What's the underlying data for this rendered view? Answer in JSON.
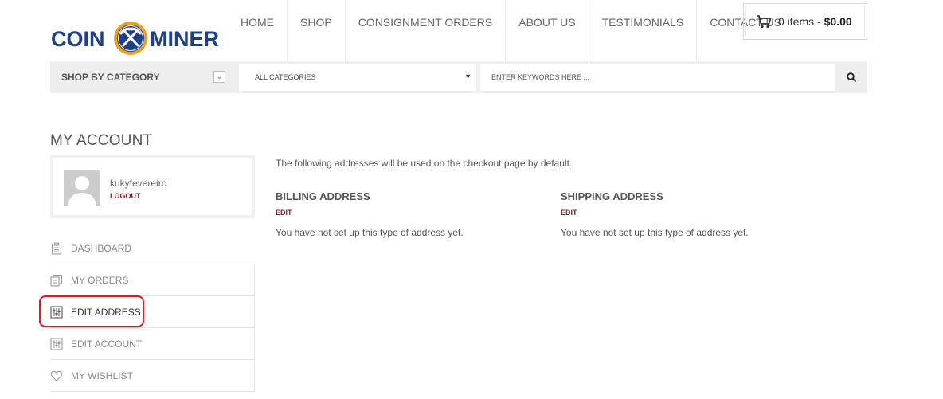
{
  "logo": {
    "left_text": "COIN",
    "right_text": "MINER"
  },
  "nav": {
    "items": [
      {
        "label": "HOME"
      },
      {
        "label": "SHOP"
      },
      {
        "label": "CONSIGNMENT ORDERS"
      },
      {
        "label": "ABOUT US"
      },
      {
        "label": "TESTIMONIALS"
      },
      {
        "label": "CONTACT US"
      }
    ]
  },
  "cart": {
    "items_label": "0 items -",
    "total": "$0.00",
    "icon": "cart-icon"
  },
  "searchbar": {
    "shop_by_label": "SHOP BY CATEGORY",
    "category_value": "ALL CATEGORIES",
    "search_placeholder": "ENTER KEYWORDS HERE ...",
    "search_icon": "search-icon"
  },
  "account": {
    "title": "MY ACCOUNT",
    "username": "kukyfevereiro",
    "logout_label": "LOGOUT"
  },
  "menu": {
    "items": [
      {
        "label": "DASHBOARD",
        "icon": "clipboard-icon"
      },
      {
        "label": "MY ORDERS",
        "icon": "orders-icon"
      },
      {
        "label": "EDIT ADDRESS",
        "icon": "sliders-icon"
      },
      {
        "label": "EDIT ACCOUNT",
        "icon": "sliders-icon"
      },
      {
        "label": "MY WISHLIST",
        "icon": "heart-icon"
      }
    ],
    "active": "EDIT ADDRESS"
  },
  "content": {
    "intro": "The following addresses will be used on the checkout page by default.",
    "billing": {
      "title": "BILLING ADDRESS",
      "edit_label": "EDIT",
      "empty_text": "You have not set up this type of address yet."
    },
    "shipping": {
      "title": "SHIPPING ADDRESS",
      "edit_label": "EDIT",
      "empty_text": "You have not set up this type of address yet."
    }
  },
  "colors": {
    "brand_blue": "#1e3f8a",
    "accent_gold": "#e7a21e",
    "link_red": "#8b1a1a",
    "highlight_red": "#e0191e"
  }
}
